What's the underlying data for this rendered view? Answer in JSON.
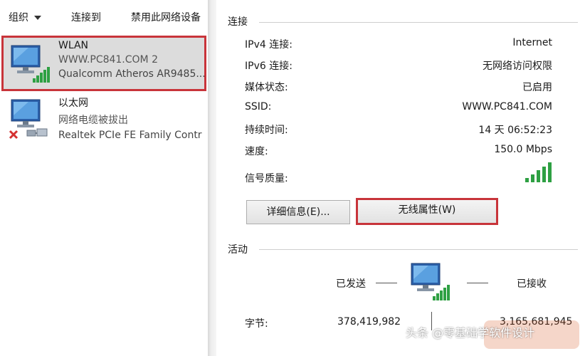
{
  "toolbar": {
    "organize_label": "组织",
    "connect_label": "连接到",
    "disable_label": "禁用此网络设备"
  },
  "connections": [
    {
      "name": "WLAN",
      "status": "WWW.PC841.COM  2",
      "adapter": "Qualcomm Atheros AR9485...",
      "selected": true,
      "icon": "wifi-computer-icon"
    },
    {
      "name": "以太网",
      "status": "网络电缆被拔出",
      "adapter": "Realtek PCIe FE Family Contr",
      "selected": false,
      "icon": "ethernet-disconnected-icon"
    }
  ],
  "status_dialog": {
    "connection_section": "连接",
    "properties": [
      {
        "key": "IPv4 连接:",
        "value": "Internet"
      },
      {
        "key": "IPv6 连接:",
        "value": "无网络访问权限"
      },
      {
        "key": "媒体状态:",
        "value": "已启用"
      },
      {
        "key": "SSID:",
        "value": "WWW.PC841.COM"
      },
      {
        "key": "持续时间:",
        "value": "14 天 06:52:23"
      },
      {
        "key": "速度:",
        "value": "150.0 Mbps"
      },
      {
        "key": "信号质量:",
        "value": ""
      }
    ],
    "signal_quality_bars": 5,
    "signal_quality_max": 5,
    "details_button": "详细信息(E)...",
    "wireless_props_button": "无线属性(W)",
    "activity_section": "活动",
    "sent_label": "已发送",
    "received_label": "已接收",
    "bytes_label": "字节:",
    "bytes_sent": "378,419,982",
    "bytes_received": "3,165,681,945"
  },
  "watermark": "头条 @零基础学软件设计",
  "colors": {
    "highlight_border": "#c8343a",
    "selected_bg": "#dcdcdc",
    "signal_green": "#2ea043"
  }
}
